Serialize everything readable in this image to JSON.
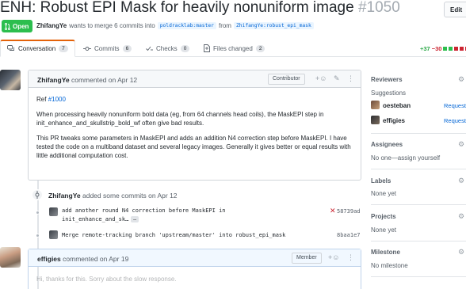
{
  "header": {
    "title": "ENH: Robust EPI Mask for heavily nonuniform image",
    "number": "#1050",
    "edit_label": "Edit",
    "state": "Open",
    "author": "ZhifangYe",
    "merge_text": "wants to merge 6 commits into",
    "base_branch": "poldracklab:master",
    "from_text": "from",
    "head_branch": "ZhifangYe:robust_epi_mask"
  },
  "tabs": [
    {
      "label": "Conversation",
      "count": "7",
      "icon": "comment-discussion-icon"
    },
    {
      "label": "Commits",
      "count": "6",
      "icon": "git-commit-icon"
    },
    {
      "label": "Checks",
      "count": "0",
      "icon": "checklist-icon"
    },
    {
      "label": "Files changed",
      "count": "2",
      "icon": "file-diff-icon"
    }
  ],
  "diffstat": {
    "additions": "+37",
    "deletions": "−30"
  },
  "comment": {
    "author": "ZhifangYe",
    "action": "commented on Apr 12",
    "role": "Contributor",
    "ref_prefix": "Ref",
    "ref_link": "#1000",
    "paragraph1": "When processing heavily nonuniform bold data (eg, from 64 channels head coils), the MaskEPI step in init_enhance_and_skullstrip_bold_wf often give bad results.",
    "paragraph2": "This PR tweaks some parameters in MaskEPI and adds an addition N4 correction step before MaskEPI. I have tested the code on a multiband dataset and several legacy images. Generally it gives better or equal results with little additional computation cost."
  },
  "commits_event": {
    "author": "ZhifangYe",
    "action": "added some commits on Apr 12",
    "commits": [
      {
        "line1": "add another round N4 correction before MaskEPI in",
        "line2": "init_enhance_and_sk…",
        "more": "…",
        "sha": "58739ad",
        "status": "failure"
      },
      {
        "line1": "Merge remote-tracking branch 'upstream/master' into robust_epi_mask",
        "line2": "",
        "more": "",
        "sha": "8baa1e7",
        "status": ""
      }
    ]
  },
  "comment2": {
    "author": "effigies",
    "action": "commented on Apr 19",
    "role": "Member",
    "body_preview": "Hi, thanks for this. Sorry about the slow response."
  },
  "sidebar": {
    "reviewers_title": "Reviewers",
    "suggestions_label": "Suggestions",
    "reviewers": [
      {
        "name": "oesteban",
        "action": "Request"
      },
      {
        "name": "effigies",
        "action": "Request"
      }
    ],
    "assignees_title": "Assignees",
    "assignees_text": "No one—assign yourself",
    "labels_title": "Labels",
    "labels_text": "None yet",
    "projects_title": "Projects",
    "projects_text": "None yet",
    "milestone_title": "Milestone",
    "milestone_text": "No milestone"
  },
  "colors": {
    "open_green": "#2cbe4e",
    "link_blue": "#0366d6",
    "active_tab_orange": "#e36209",
    "addition_green": "#28a745",
    "deletion_red": "#cb2431"
  }
}
